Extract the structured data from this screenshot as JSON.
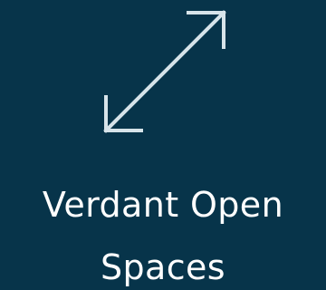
{
  "logo": {
    "icon": "diagonal-double-arrow-icon",
    "line1": "Verdant Open",
    "line2": "Spaces"
  },
  "colors": {
    "background": "#07344a",
    "icon": "#d7e4ea",
    "text": "#ffffff"
  }
}
